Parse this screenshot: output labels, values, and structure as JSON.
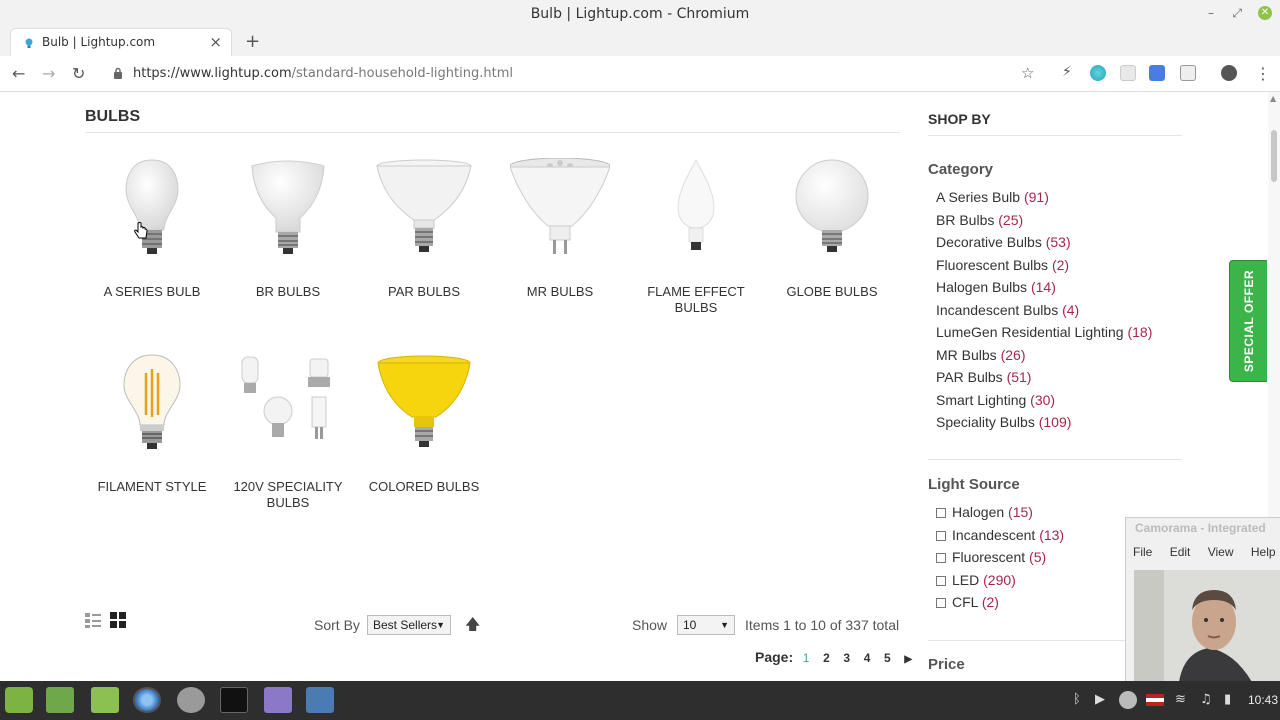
{
  "window": {
    "title": "Bulb | Lightup.com - Chromium"
  },
  "tab": {
    "title": "Bulb | Lightup.com"
  },
  "address": {
    "host": "https://www.lightup.com",
    "path": "/standard-household-lighting.html"
  },
  "section": {
    "title": "BULBS"
  },
  "products": [
    {
      "name": "A SERIES BULB",
      "icon": "a-series-bulb-icon"
    },
    {
      "name": "BR BULBS",
      "icon": "br-bulb-icon"
    },
    {
      "name": "PAR BULBS",
      "icon": "par-bulb-icon"
    },
    {
      "name": "MR BULBS",
      "icon": "mr-bulb-icon"
    },
    {
      "name": "FLAME EFFECT BULBS",
      "icon": "flame-bulb-icon"
    },
    {
      "name": "GLOBE BULBS",
      "icon": "globe-bulb-icon"
    },
    {
      "name": "FILAMENT STYLE",
      "icon": "filament-bulb-icon"
    },
    {
      "name": "120V SPECIALITY BULBS",
      "icon": "speciality-bulb-icon"
    },
    {
      "name": "COLORED BULBS",
      "icon": "colored-bulb-icon"
    }
  ],
  "toolbar": {
    "sort_label": "Sort By",
    "sort_value": "Best Sellers",
    "show_label": "Show",
    "show_value": "10",
    "items_total": "Items 1 to 10 of 337 total",
    "page_label": "Page:",
    "pages": [
      "1",
      "2",
      "3",
      "4",
      "5"
    ],
    "current_page": "1"
  },
  "sidebar": {
    "title": "SHOP BY",
    "category_heading": "Category",
    "categories": [
      {
        "label": "A Series Bulb",
        "count": "(91)"
      },
      {
        "label": "BR Bulbs",
        "count": "(25)"
      },
      {
        "label": "Decorative Bulbs",
        "count": "(53)"
      },
      {
        "label": "Fluorescent Bulbs",
        "count": "(2)"
      },
      {
        "label": "Halogen Bulbs",
        "count": "(14)"
      },
      {
        "label": "Incandescent Bulbs",
        "count": "(4)"
      },
      {
        "label": "LumeGen Residential Lighting",
        "count": "(18)"
      },
      {
        "label": "MR Bulbs",
        "count": "(26)"
      },
      {
        "label": "PAR Bulbs",
        "count": "(51)"
      },
      {
        "label": "Smart Lighting",
        "count": "(30)"
      },
      {
        "label": "Speciality Bulbs",
        "count": "(109)"
      }
    ],
    "light_source_heading": "Light Source",
    "light_sources": [
      {
        "label": "Halogen",
        "count": "(15)"
      },
      {
        "label": "Incandescent",
        "count": "(13)"
      },
      {
        "label": "Fluorescent",
        "count": "(5)"
      },
      {
        "label": "LED",
        "count": "(290)"
      },
      {
        "label": "CFL",
        "count": "(2)"
      }
    ],
    "price_heading": "Price"
  },
  "special_offer": "SPECIAL OFFER",
  "camorama": {
    "title": "Camorama - Integrated",
    "menu": [
      "File",
      "Edit",
      "View",
      "Help"
    ]
  },
  "taskbar": {
    "clock": "10:43"
  },
  "colors": {
    "count": "#a4274b",
    "accent_green": "#3bb54a",
    "page_current": "#4aa3a2",
    "taskbar": "#2e2e2e"
  }
}
